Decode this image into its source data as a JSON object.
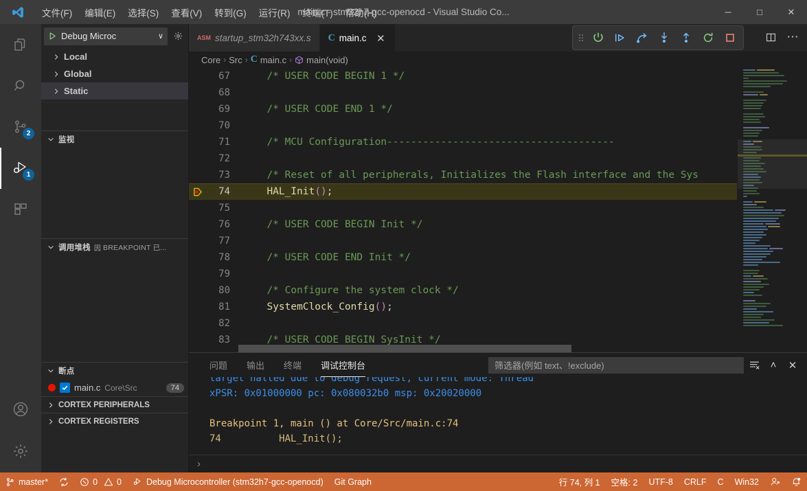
{
  "titlebar": {
    "app_title": "main.c - stm32h7-gcc-openocd - Visual Studio Co...",
    "menus": [
      {
        "label": "文件(F)",
        "name": "menu-file"
      },
      {
        "label": "编辑(E)",
        "name": "menu-edit"
      },
      {
        "label": "选择(S)",
        "name": "menu-selection"
      },
      {
        "label": "查看(V)",
        "name": "menu-view"
      },
      {
        "label": "转到(G)",
        "name": "menu-go"
      },
      {
        "label": "运行(R)",
        "name": "menu-run"
      },
      {
        "label": "终端(T)",
        "name": "menu-terminal"
      },
      {
        "label": "帮助(H)",
        "name": "menu-help"
      }
    ],
    "minimize": "─",
    "maximize": "□",
    "close": "✕"
  },
  "activitybar": {
    "items": [
      {
        "name": "explorer-icon",
        "badge": ""
      },
      {
        "name": "search-icon",
        "badge": ""
      },
      {
        "name": "source-control-icon",
        "badge": "2"
      },
      {
        "name": "run-debug-icon",
        "badge": "1"
      },
      {
        "name": "extensions-icon",
        "badge": ""
      }
    ],
    "account_icon": "account-icon",
    "settings_icon": "gear-icon"
  },
  "sidebar": {
    "launch_config": "Debug Microc",
    "launch_chevron": "∨",
    "variables": {
      "rows": [
        {
          "label": "Local",
          "selected": false
        },
        {
          "label": "Global",
          "selected": false
        },
        {
          "label": "Static",
          "selected": true
        }
      ]
    },
    "watch": {
      "title": "监视"
    },
    "callstack": {
      "title": "调用堆栈",
      "subtitle": "BREAKPOINT 已...",
      "sub_icon": "因"
    },
    "breakpoints": {
      "title": "断点",
      "items": [
        {
          "file": "main.c",
          "path": "Core\\Src",
          "line": "74",
          "checked": true
        }
      ]
    },
    "sections": [
      {
        "label": "CORTEX PERIPHERALS",
        "name": "section-cortex-peripherals"
      },
      {
        "label": "CORTEX REGISTERS",
        "name": "section-cortex-registers"
      }
    ]
  },
  "tabs": [
    {
      "label": "startup_stm32h743xx.s",
      "icon": "ASM",
      "active": false,
      "italic": true
    },
    {
      "label": "main.c",
      "icon": "C",
      "active": true,
      "italic": false,
      "close": "✕"
    }
  ],
  "debug_toolbar": {
    "buttons": [
      {
        "name": "continue-button",
        "title": "continue"
      },
      {
        "name": "step-over-button",
        "title": "step over"
      },
      {
        "name": "step-into-button",
        "title": "step into"
      },
      {
        "name": "step-out-button",
        "title": "step out"
      },
      {
        "name": "restart-button",
        "title": "restart"
      },
      {
        "name": "stop-button",
        "title": "stop"
      }
    ]
  },
  "editor_actions": [
    {
      "name": "split-editor-icon"
    },
    {
      "name": "more-actions-icon",
      "glyph": "⋯"
    }
  ],
  "breadcrumb": {
    "parts": [
      "Core",
      "Src",
      "main.c",
      "main(void)"
    ],
    "separator": "›"
  },
  "code": {
    "lines": [
      {
        "n": "67",
        "indent": true,
        "current": false,
        "tokens": [
          {
            "t": "  ",
            "c": "pln"
          },
          {
            "t": "/* USER CODE BEGIN 1 */",
            "c": "cmt"
          }
        ]
      },
      {
        "n": "68",
        "indent": true,
        "current": false,
        "tokens": []
      },
      {
        "n": "69",
        "indent": true,
        "current": false,
        "tokens": [
          {
            "t": "  ",
            "c": "pln"
          },
          {
            "t": "/* USER CODE END 1 */",
            "c": "cmt"
          }
        ]
      },
      {
        "n": "70",
        "indent": true,
        "current": false,
        "tokens": []
      },
      {
        "n": "71",
        "indent": true,
        "current": false,
        "tokens": [
          {
            "t": "  ",
            "c": "pln"
          },
          {
            "t": "/* MCU Configuration--------------------------------------",
            "c": "cmt"
          }
        ]
      },
      {
        "n": "72",
        "indent": true,
        "current": false,
        "tokens": []
      },
      {
        "n": "73",
        "indent": true,
        "current": false,
        "tokens": [
          {
            "t": "  ",
            "c": "pln"
          },
          {
            "t": "/* Reset of all peripherals, Initializes the Flash interface and the Sys",
            "c": "cmt"
          }
        ]
      },
      {
        "n": "74",
        "indent": true,
        "current": true,
        "breakpoint": true,
        "tokens": [
          {
            "t": "  ",
            "c": "pln"
          },
          {
            "t": "HAL_Init",
            "c": "fn"
          },
          {
            "t": "(",
            "c": "paren"
          },
          {
            "t": ")",
            "c": "paren"
          },
          {
            "t": ";",
            "c": "pln"
          }
        ]
      },
      {
        "n": "75",
        "indent": true,
        "current": false,
        "tokens": []
      },
      {
        "n": "76",
        "indent": true,
        "current": false,
        "tokens": [
          {
            "t": "  ",
            "c": "pln"
          },
          {
            "t": "/* USER CODE BEGIN Init */",
            "c": "cmt"
          }
        ]
      },
      {
        "n": "77",
        "indent": true,
        "current": false,
        "tokens": []
      },
      {
        "n": "78",
        "indent": true,
        "current": false,
        "tokens": [
          {
            "t": "  ",
            "c": "pln"
          },
          {
            "t": "/* USER CODE END Init */",
            "c": "cmt"
          }
        ]
      },
      {
        "n": "79",
        "indent": true,
        "current": false,
        "tokens": []
      },
      {
        "n": "80",
        "indent": true,
        "current": false,
        "tokens": [
          {
            "t": "  ",
            "c": "pln"
          },
          {
            "t": "/* Configure the system clock */",
            "c": "cmt"
          }
        ]
      },
      {
        "n": "81",
        "indent": true,
        "current": false,
        "tokens": [
          {
            "t": "  ",
            "c": "pln"
          },
          {
            "t": "SystemClock_Config",
            "c": "fn"
          },
          {
            "t": "(",
            "c": "paren"
          },
          {
            "t": ")",
            "c": "paren"
          },
          {
            "t": ";",
            "c": "pln"
          }
        ]
      },
      {
        "n": "82",
        "indent": true,
        "current": false,
        "tokens": []
      },
      {
        "n": "83",
        "indent": true,
        "current": false,
        "tokens": [
          {
            "t": "  ",
            "c": "pln"
          },
          {
            "t": "/* USER CODE BEGIN SysInit */",
            "c": "cmt"
          }
        ]
      }
    ]
  },
  "panel": {
    "tabs": [
      {
        "label": "问题",
        "name": "tab-problems",
        "active": false
      },
      {
        "label": "输出",
        "name": "tab-output",
        "active": false
      },
      {
        "label": "终端",
        "name": "tab-terminal",
        "active": false
      },
      {
        "label": "调试控制台",
        "name": "tab-debug-console",
        "active": true
      }
    ],
    "filter_placeholder": "筛选器(例如 text、!exclude)",
    "actions": [
      {
        "name": "clear-console-icon"
      },
      {
        "name": "collapse-panel-icon",
        "glyph": "˄"
      },
      {
        "name": "close-panel-icon",
        "glyph": "✕"
      }
    ],
    "console_lines": [
      {
        "text": "target halted due to debug request, current mode: Thread",
        "color": "c-blue",
        "clipped": true
      },
      {
        "text": "xPSR: 0x01000000 pc: 0x080032b0 msp: 0x20020000",
        "color": "c-blue"
      },
      {
        "text": "",
        "color": "c-blue"
      },
      {
        "text": "Breakpoint 1, main () at Core/Src/main.c:74",
        "color": "c-yellow"
      },
      {
        "text": "74          HAL_Init();",
        "color": "c-yellow2"
      }
    ],
    "repl_prompt": "›"
  },
  "statusbar": {
    "branch": "master*",
    "sync_icon": "sync-icon",
    "errors": "0",
    "warnings": "0",
    "debug_session": "Debug Microcontroller (stm32h7-gcc-openocd)",
    "git_graph": "Git Graph",
    "position": "行 74, 列 1",
    "indentation": "空格: 2",
    "encoding": "UTF-8",
    "eol": "CRLF",
    "language": "C",
    "platform": "Win32",
    "feedback_icon": "feedback-icon",
    "bell_icon": "bell-icon",
    "background": "#cc6633"
  },
  "minimap": {
    "palette": {
      "comment": "#3f5b3f",
      "code": "#4a6b8a",
      "keyword": "#6a6a9a",
      "string": "#8a7a4a",
      "current": "#5a5320"
    }
  }
}
